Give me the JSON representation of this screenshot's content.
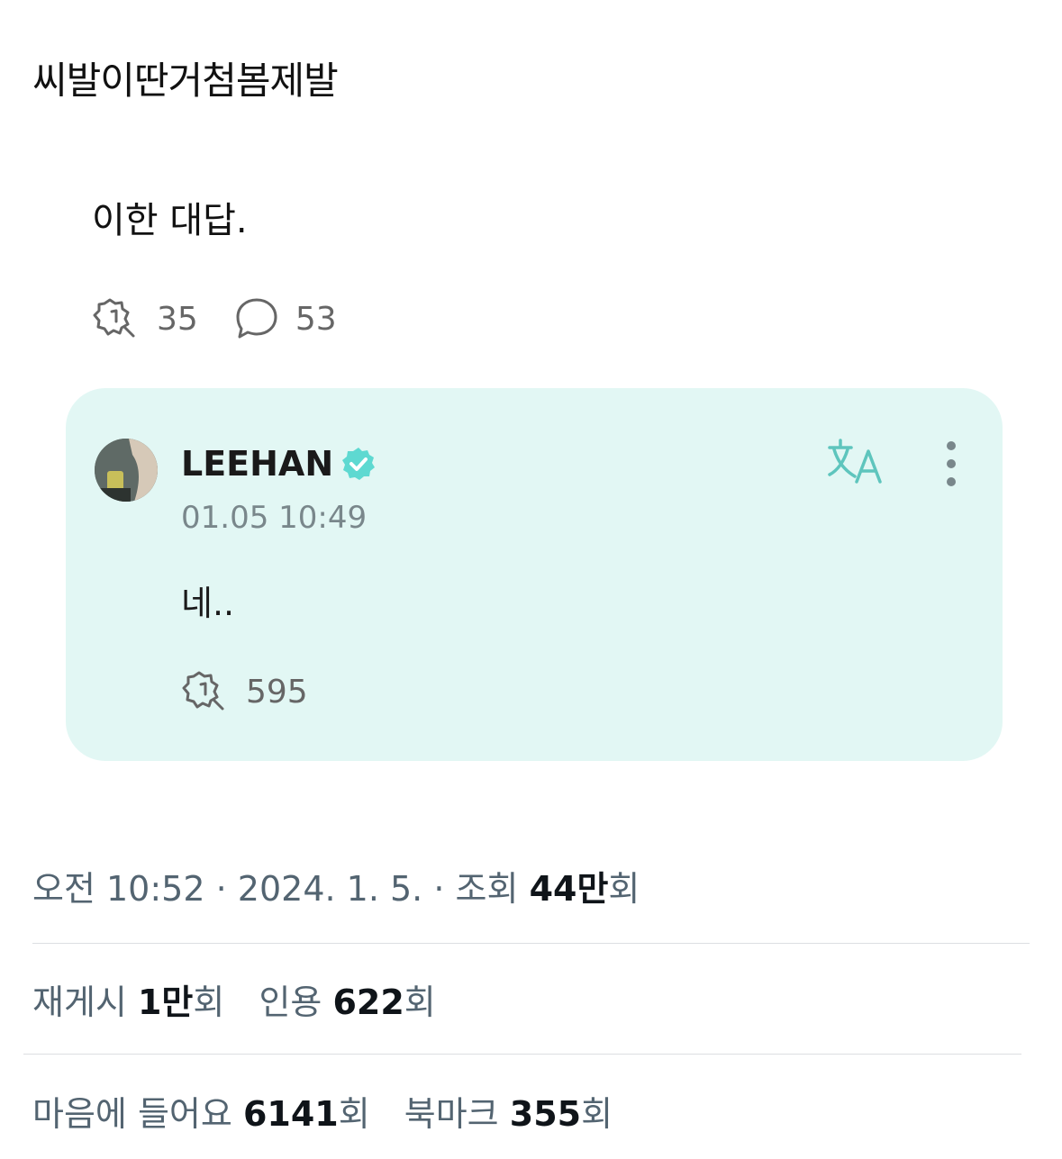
{
  "tweet": {
    "text": "씨발이딴거첨봄제발",
    "quoted_text": "이한 대답.",
    "quoted_stats": {
      "reposts": "35",
      "comments": "53"
    }
  },
  "card": {
    "author_name": "LEEHAN",
    "timestamp": "01.05 10:49",
    "body": "네..",
    "reposts": "595",
    "accent_color": "#5ed9d1",
    "background_color": "#e2f7f4"
  },
  "meta": {
    "time": "오전 10:52",
    "separator": "·",
    "date": "2024. 1. 5.",
    "views_label": "조회",
    "views_value": "44만",
    "views_unit": "회"
  },
  "engagement": {
    "reposts_label": "재게시",
    "reposts_value": "1만",
    "quotes_label": "인용",
    "quotes_value": "622",
    "likes_label": "마음에 들어요",
    "likes_value": "6141",
    "bookmarks_label": "북마크",
    "bookmarks_value": "355",
    "unit": "회"
  }
}
